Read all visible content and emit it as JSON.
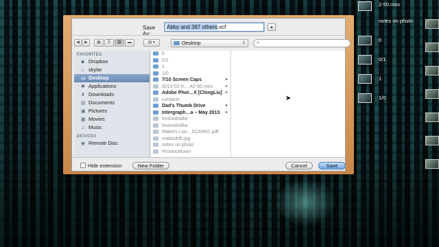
{
  "dialog": {
    "save_as_label": "Save As:",
    "filename_selected": "Abby and 387 others",
    "filename_ext": ".vcf",
    "expand_glyph": "▲",
    "location": "Desktop",
    "search_placeholder": "",
    "hide_extension_label": "Hide extension",
    "new_folder_label": "New Folder",
    "cancel_label": "Cancel",
    "save_label": "Save"
  },
  "sidebar": {
    "favorites_header": "FAVORITES",
    "devices_header": "DEVICES",
    "favorites": [
      {
        "label": "Dropbox",
        "icon": "dropbox-icon"
      },
      {
        "label": "skylar",
        "icon": "home-icon"
      },
      {
        "label": "Desktop",
        "icon": "desktop-icon"
      },
      {
        "label": "Applications",
        "icon": "applications-icon"
      },
      {
        "label": "Downloads",
        "icon": "downloads-icon"
      },
      {
        "label": "Documents",
        "icon": "documents-icon"
      },
      {
        "label": "Pictures",
        "icon": "pictures-icon"
      },
      {
        "label": "Movies",
        "icon": "movies-icon"
      },
      {
        "label": "Music",
        "icon": "music-icon"
      }
    ],
    "devices": [
      {
        "label": "Remote Disc",
        "icon": "disc-icon"
      }
    ]
  },
  "files": [
    {
      "name": "0",
      "kind": "folder",
      "style": "dim",
      "more": false
    },
    {
      "name": "0/1",
      "kind": "folder",
      "style": "dim",
      "more": false
    },
    {
      "name": "1",
      "kind": "folder",
      "style": "dim",
      "more": false
    },
    {
      "name": "1/0",
      "kind": "folder",
      "style": "dim",
      "more": false
    },
    {
      "name": "7/10 Screen Caps",
      "kind": "folder",
      "style": "bold",
      "more": true
    },
    {
      "name": "2013-02-0…-42-50.mov",
      "kind": "file",
      "style": "dim",
      "more": true
    },
    {
      "name": "Adobe Phot…X [ChingLiu]",
      "kind": "folder",
      "style": "bold",
      "more": true
    },
    {
      "name": "contacts",
      "kind": "file",
      "style": "dim",
      "more": false
    },
    {
      "name": "Dad's Thumb Drive",
      "kind": "folder",
      "style": "bold",
      "more": true
    },
    {
      "name": "Intergraph…a – May 2013",
      "kind": "folder",
      "style": "bold",
      "more": true
    },
    {
      "name": "lmxlookslike",
      "kind": "file",
      "style": "dim",
      "more": false
    },
    {
      "name": "lmxlookslike",
      "kind": "file",
      "style": "dim",
      "more": false
    },
    {
      "name": "Makers Loo…0120401.pdf",
      "kind": "file",
      "style": "dim",
      "more": false
    },
    {
      "name": "makeshift.jpg",
      "kind": "file",
      "style": "dim",
      "more": false
    },
    {
      "name": "notes on photo",
      "kind": "file",
      "style": "dim",
      "more": false
    },
    {
      "name": "Provincetown",
      "kind": "file",
      "style": "dim",
      "more": false
    }
  ],
  "desktop": {
    "labels": [
      "2-50.mov",
      "notes on photo",
      "0",
      "0/1",
      "1",
      "1/0"
    ]
  }
}
